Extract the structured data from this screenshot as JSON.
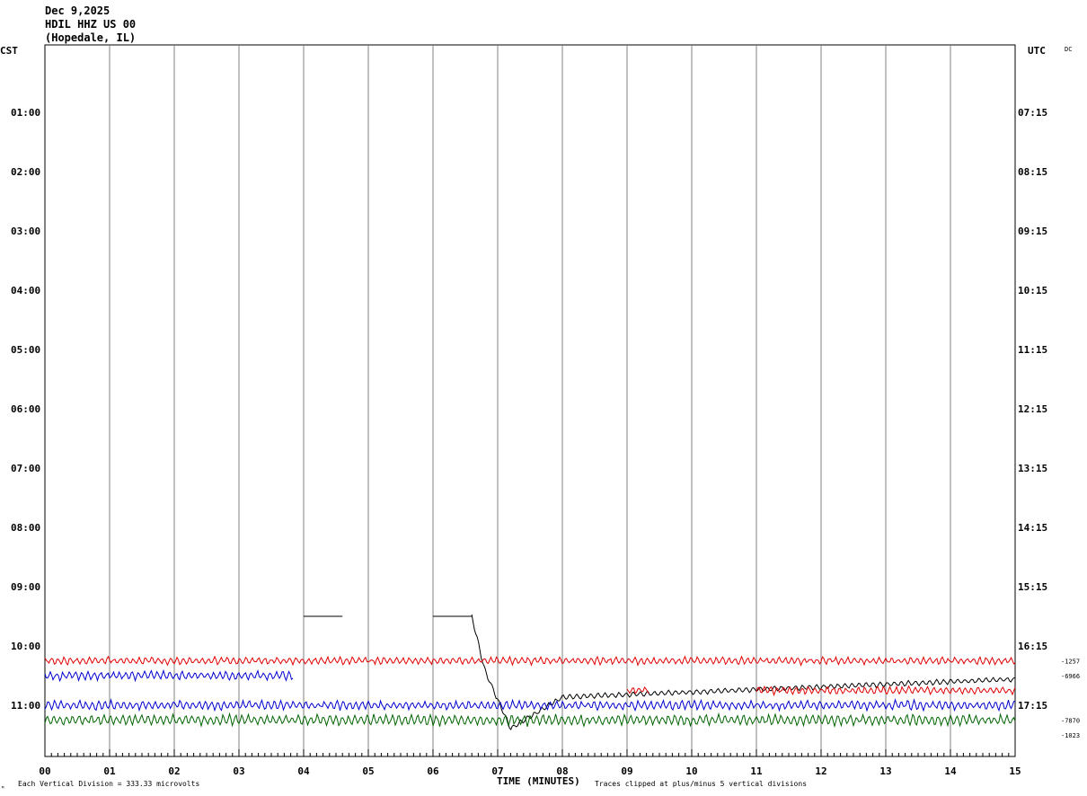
{
  "header": {
    "date": "Dec 9,2025",
    "station": "HDIL HHZ US 00",
    "location": "(Hopedale, IL)"
  },
  "left_zone": "CST",
  "right_zone": "UTC",
  "dc_label": "DC",
  "footer": {
    "scale_note": "Each Vertical Division =  333.33 microvolts",
    "xlabel": "TIME (MINUTES)",
    "clip_note": "Traces clipped at plus/minus 5 vertical divisions",
    "corner_mark": "ᴹ"
  },
  "colors": {
    "black": "#000000",
    "red": "#e00000",
    "blue": "#0000d0",
    "green": "#006400",
    "grid": "#808080"
  },
  "chart_data": {
    "type": "line",
    "title": "HDIL HHZ US 00 (Hopedale, IL)",
    "xlabel": "TIME (MINUTES)",
    "x_ticks": [
      "00",
      "01",
      "02",
      "03",
      "04",
      "05",
      "06",
      "07",
      "08",
      "09",
      "10",
      "11",
      "12",
      "13",
      "14",
      "15"
    ],
    "xlim": [
      0,
      15
    ],
    "left_labels": [
      "01:00",
      "02:00",
      "03:00",
      "04:00",
      "05:00",
      "06:00",
      "07:00",
      "08:00",
      "09:00",
      "10:00",
      "11:00"
    ],
    "right_labels": [
      "07:15",
      "08:15",
      "09:15",
      "10:15",
      "11:15",
      "12:15",
      "13:15",
      "14:15",
      "15:15",
      "16:15",
      "17:15"
    ],
    "rows_per_hour": 4,
    "row_minutes": 15,
    "offsets_right": [
      {
        "value": "-1257",
        "row": 41
      },
      {
        "value": "-6966",
        "row": 42
      },
      {
        "value": "-7870",
        "row": 45
      },
      {
        "value": "-1023",
        "row": 46
      }
    ],
    "series": [
      {
        "name": "trace-0845",
        "color": "black",
        "row": 38,
        "segments": [
          {
            "x": [
              4.0,
              4.6
            ],
            "shape": "flat"
          },
          {
            "x": [
              6.0,
              6.6
            ],
            "shape": "flat"
          },
          {
            "x": [
              6.6,
              15.0
            ],
            "shape": "drift"
          }
        ]
      },
      {
        "name": "trace-1000",
        "color": "red",
        "row": 41,
        "segments": [
          {
            "x": [
              0,
              15
            ],
            "shape": "noise"
          }
        ]
      },
      {
        "name": "trace-1015",
        "color": "blue",
        "row": 42,
        "segments": [
          {
            "x": [
              0,
              3.85
            ],
            "shape": "noise"
          }
        ]
      },
      {
        "name": "trace-1030",
        "color": "red",
        "row": 43,
        "segments": [
          {
            "x": [
              9.0,
              9.35
            ],
            "shape": "noise"
          },
          {
            "x": [
              11.0,
              15
            ],
            "shape": "noise"
          }
        ]
      },
      {
        "name": "trace-1045",
        "color": "blue",
        "row": 44,
        "segments": [
          {
            "x": [
              0,
              15
            ],
            "shape": "noise"
          }
        ]
      },
      {
        "name": "trace-1100",
        "color": "green",
        "row": 45,
        "segments": [
          {
            "x": [
              0,
              15
            ],
            "shape": "noise"
          }
        ]
      }
    ],
    "grid": true
  }
}
